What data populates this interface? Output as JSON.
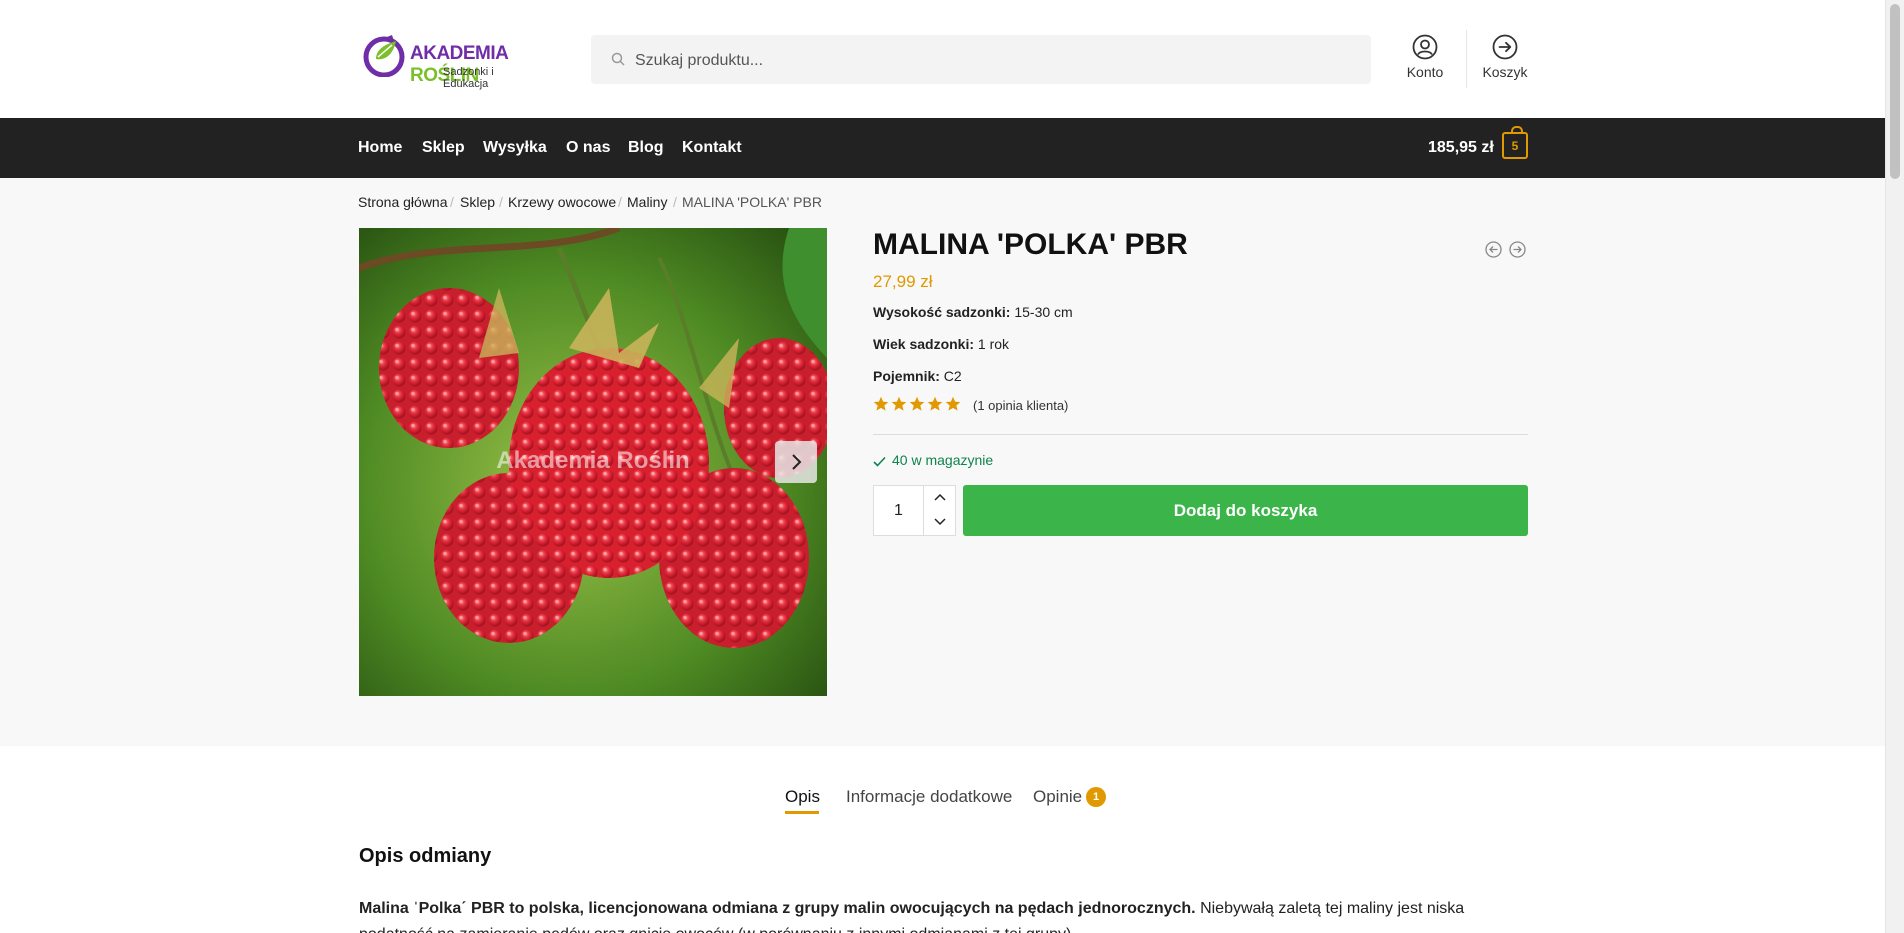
{
  "header": {
    "logo": {
      "brand_main": "AKADEMIA ",
      "brand_accent": "ROŚLIN",
      "tagline": "Sadzonki i Edukacja"
    },
    "search": {
      "placeholder": "Szukaj produktu..."
    },
    "account_label": "Konto",
    "cart_label": "Koszyk"
  },
  "nav": {
    "items": [
      "Home",
      "Sklep",
      "Wysyłka",
      "O nas",
      "Blog",
      "Kontakt"
    ],
    "cart_total": "185,95 zł",
    "cart_count": "5"
  },
  "breadcrumb": [
    "Strona główna",
    "Sklep",
    "Krzewy owocowe",
    "Maliny",
    "MALINA 'POLKA' PBR"
  ],
  "product": {
    "title": "MALINA 'POLKA' PBR",
    "price": "27,99 zł",
    "attributes": [
      {
        "label": "Wysokość sadzonki:",
        "value": " 15-30 cm"
      },
      {
        "label": "Wiek sadzonki:",
        "value": " 1 rok"
      },
      {
        "label": "Pojemnik:",
        "value": " C2"
      }
    ],
    "rating": 5,
    "review_count_text": "(1 opinia klienta)",
    "stock_text": "40 w magazynie",
    "quantity": "1",
    "add_to_cart_label": "Dodaj do koszyka",
    "image_watermark": "Akademia Roślin"
  },
  "tabs": [
    {
      "label": "Opis",
      "active": true
    },
    {
      "label": "Informacje dodatkowe",
      "active": false
    },
    {
      "label": "Opinie",
      "active": false,
      "badge": "1"
    }
  ],
  "description": {
    "heading": "Opis odmiany",
    "bold_intro": "Malina ˈPolkaˊ PBR to polska, licencjonowana odmiana z grupy malin owocujących na pędach jednorocznych.",
    "text": " Niebywałą zaletą tej maliny jest niska podatność na zamieranie pędów oraz gnicie owoców (w porównaniu z innymi odmianami z tej grupy)."
  },
  "colors": {
    "accent": "#e09900",
    "nav_bg": "#222222",
    "button_green": "#3bb54a",
    "stock_green": "#0f834d",
    "brand_purple": "#6f2da8",
    "brand_green": "#7bbf2a"
  }
}
